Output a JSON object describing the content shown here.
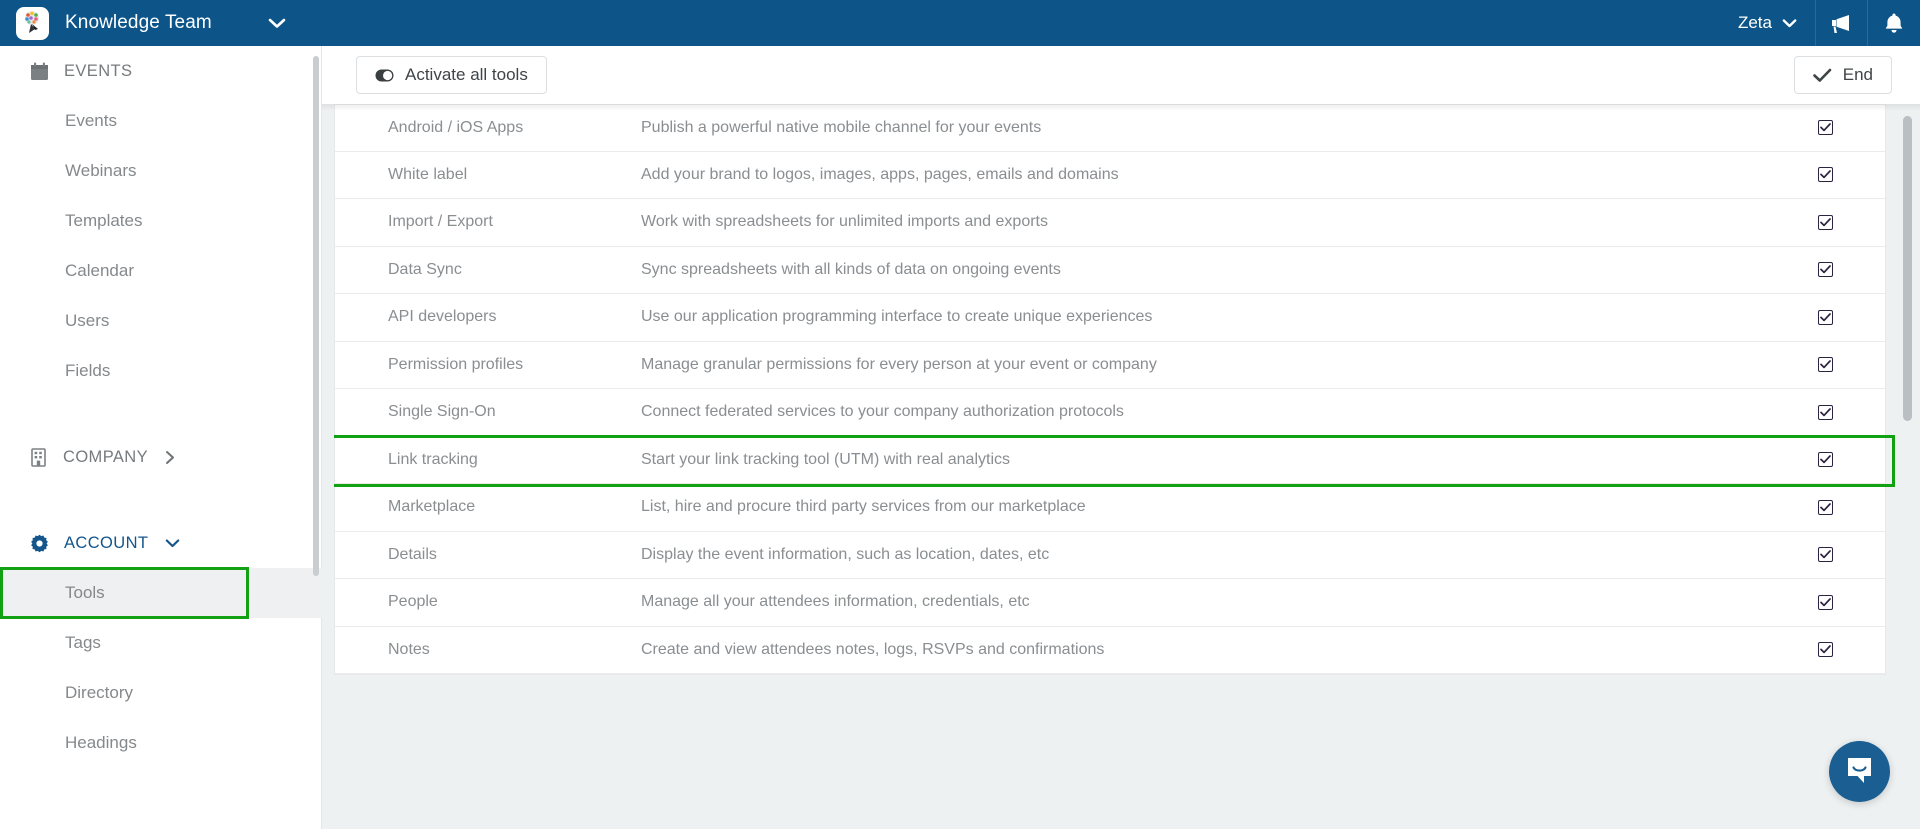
{
  "topbar": {
    "brand_name": "Knowledge Team",
    "brand_logo_icon": "brain-idea-logo",
    "brand_caret_icon": "chevron-down-icon",
    "user_name": "Zeta",
    "user_caret_icon": "chevron-down-icon",
    "announcement_icon": "megaphone-icon",
    "notifications_icon": "bell-icon",
    "background_color": "#0d5489"
  },
  "sidebar": {
    "groups": [
      {
        "label": "EVENTS",
        "icon": "calendar-icon",
        "caret": "",
        "active": false,
        "items": [
          {
            "label": "Events",
            "selected": false
          },
          {
            "label": "Webinars",
            "selected": false
          },
          {
            "label": "Templates",
            "selected": false
          },
          {
            "label": "Calendar",
            "selected": false
          },
          {
            "label": "Users",
            "selected": false
          },
          {
            "label": "Fields",
            "selected": false
          }
        ]
      },
      {
        "label": "COMPANY",
        "icon": "building-icon",
        "caret": "chevron-right-icon",
        "active": false,
        "items": []
      },
      {
        "label": "ACCOUNT",
        "icon": "gear-icon",
        "caret": "chevron-down-icon",
        "active": true,
        "items": [
          {
            "label": "Tools",
            "selected": true
          },
          {
            "label": "Tags",
            "selected": false
          },
          {
            "label": "Directory",
            "selected": false
          },
          {
            "label": "Headings",
            "selected": false
          }
        ]
      }
    ],
    "highlight_color": "#12a112",
    "highlighted_item": "Tools",
    "scrollbar": true
  },
  "toolbar": {
    "activate_all_label": "Activate all tools",
    "activate_all_icon": "toggle-switch-icon",
    "end_label": "End",
    "end_icon": "check-icon"
  },
  "table": {
    "rows": [
      {
        "name": "Android / iOS Apps",
        "description": "Publish a powerful native mobile channel for your events",
        "enabled": true,
        "highlighted": false
      },
      {
        "name": "White label",
        "description": "Add your brand to logos, images, apps, pages, emails and domains",
        "enabled": true,
        "highlighted": false
      },
      {
        "name": "Import / Export",
        "description": "Work with spreadsheets for unlimited imports and exports",
        "enabled": true,
        "highlighted": false
      },
      {
        "name": "Data Sync",
        "description": "Sync spreadsheets with all kinds of data on ongoing events",
        "enabled": true,
        "highlighted": false
      },
      {
        "name": "API developers",
        "description": "Use our application programming interface to create unique experiences",
        "enabled": true,
        "highlighted": false
      },
      {
        "name": "Permission profiles",
        "description": "Manage granular permissions for every person at your event or company",
        "enabled": true,
        "highlighted": false
      },
      {
        "name": "Single Sign-On",
        "description": "Connect federated services to your company authorization protocols",
        "enabled": true,
        "highlighted": false
      },
      {
        "name": "Link tracking",
        "description": "Start your link tracking tool (UTM) with real analytics",
        "enabled": true,
        "highlighted": true
      },
      {
        "name": "Marketplace",
        "description": "List, hire and procure third party services from our marketplace",
        "enabled": true,
        "highlighted": false
      },
      {
        "name": "Details",
        "description": "Display the event information, such as location, dates, etc",
        "enabled": true,
        "highlighted": false
      },
      {
        "name": "People",
        "description": "Manage all your attendees information, credentials, etc",
        "enabled": true,
        "highlighted": false
      },
      {
        "name": "Notes",
        "description": "Create and view attendees notes, logs, RSVPs and confirmations",
        "enabled": true,
        "highlighted": false
      }
    ],
    "checkbox_icon": "checked-checkbox-icon",
    "highlight_color": "#12a112"
  },
  "chat": {
    "launcher_icon": "chat-bubble-smile-icon",
    "launcher_color": "#1a5e92"
  }
}
